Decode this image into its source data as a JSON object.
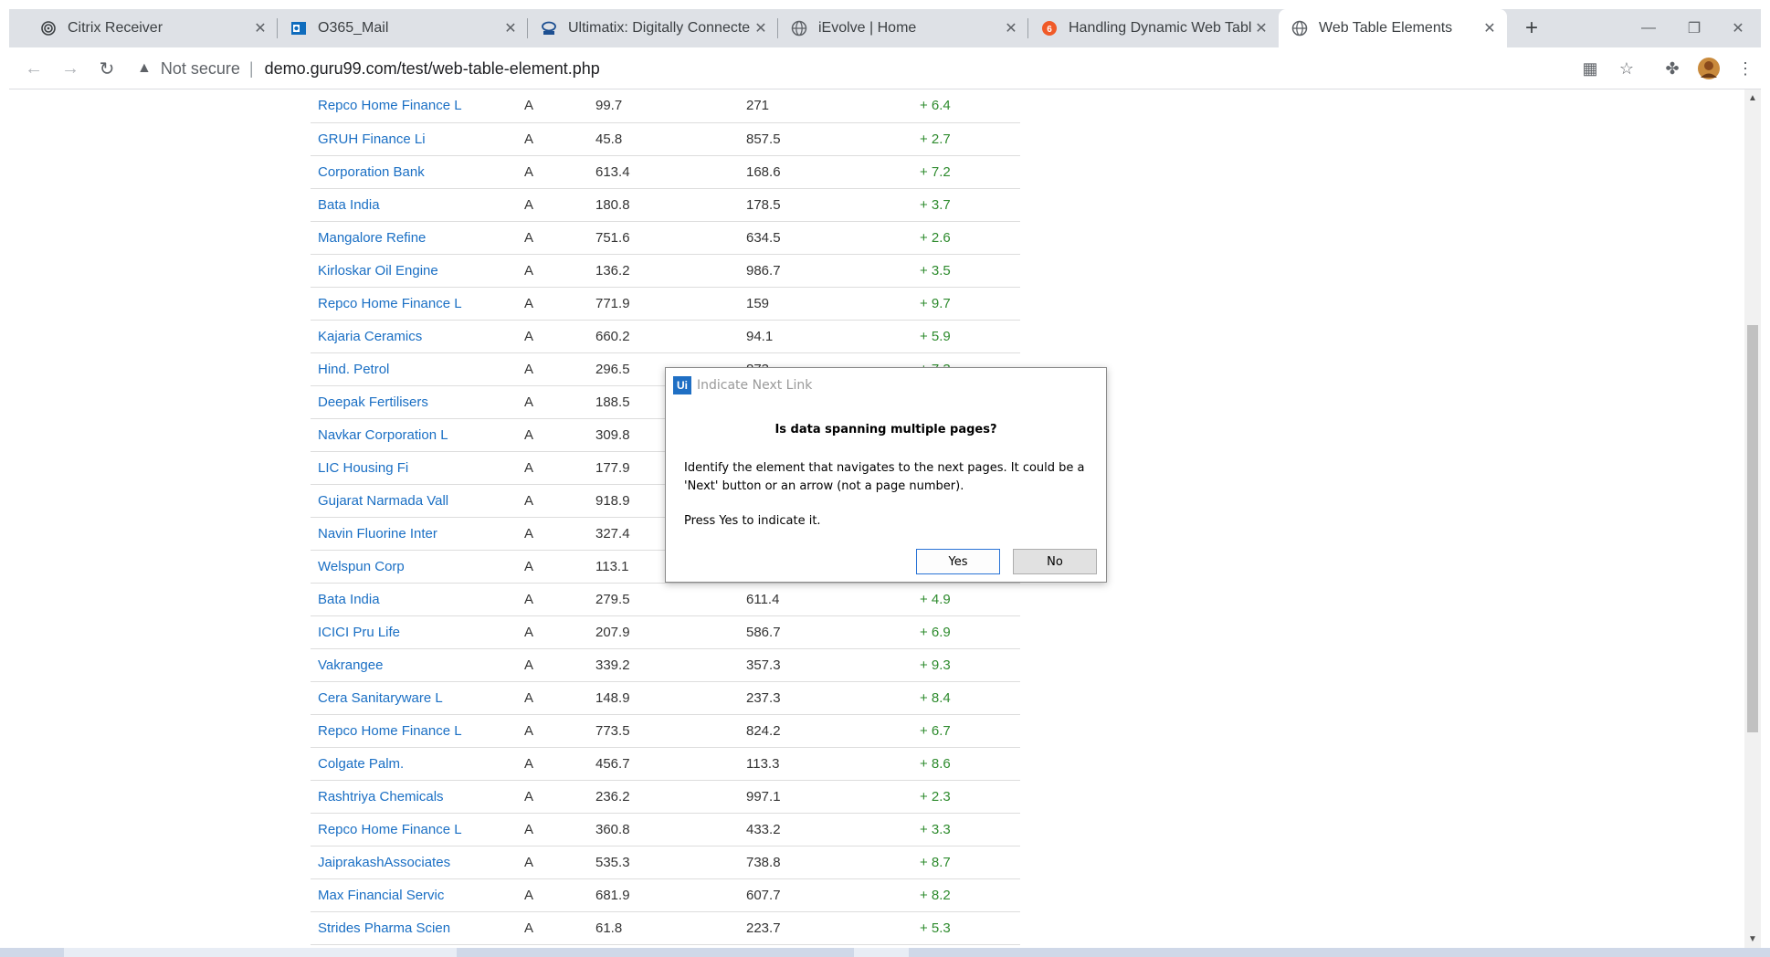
{
  "browser": {
    "tabs": [
      {
        "title": "Citrix Receiver",
        "icon": "citrix-icon"
      },
      {
        "title": "O365_Mail",
        "icon": "outlook-icon"
      },
      {
        "title": "Ultimatix: Digitally Connecte",
        "icon": "tata-icon"
      },
      {
        "title": "iEvolve | Home",
        "icon": "globe-icon"
      },
      {
        "title": "Handling Dynamic Web Tabl",
        "icon": "guru99-icon"
      },
      {
        "title": "Web Table Elements",
        "icon": "globe-icon"
      }
    ],
    "active_tab": 5,
    "security_label": "Not secure",
    "url": "demo.guru99.com/test/web-table-element.php"
  },
  "table": {
    "rows": [
      {
        "company": "Repco Home Finance L",
        "group": "A",
        "prev_close": "99.7",
        "current_price": "271",
        "change": "+ 6.4"
      },
      {
        "company": "GRUH Finance Li",
        "group": "A",
        "prev_close": "45.8",
        "current_price": "857.5",
        "change": "+ 2.7"
      },
      {
        "company": "Corporation Bank",
        "group": "A",
        "prev_close": "613.4",
        "current_price": "168.6",
        "change": "+ 7.2"
      },
      {
        "company": "Bata India",
        "group": "A",
        "prev_close": "180.8",
        "current_price": "178.5",
        "change": "+ 3.7"
      },
      {
        "company": "Mangalore Refine",
        "group": "A",
        "prev_close": "751.6",
        "current_price": "634.5",
        "change": "+ 2.6"
      },
      {
        "company": "Kirloskar Oil Engine",
        "group": "A",
        "prev_close": "136.2",
        "current_price": "986.7",
        "change": "+ 3.5"
      },
      {
        "company": "Repco Home Finance L",
        "group": "A",
        "prev_close": "771.9",
        "current_price": "159",
        "change": "+ 9.7"
      },
      {
        "company": "Kajaria Ceramics",
        "group": "A",
        "prev_close": "660.2",
        "current_price": "94.1",
        "change": "+ 5.9"
      },
      {
        "company": "Hind. Petrol",
        "group": "A",
        "prev_close": "296.5",
        "current_price": "873",
        "change": "+ 7.3"
      },
      {
        "company": "Deepak Fertilisers",
        "group": "A",
        "prev_close": "188.5",
        "current_price": "",
        "change": ""
      },
      {
        "company": "Navkar Corporation L",
        "group": "A",
        "prev_close": "309.8",
        "current_price": "",
        "change": ""
      },
      {
        "company": "LIC Housing Fi",
        "group": "A",
        "prev_close": "177.9",
        "current_price": "",
        "change": ""
      },
      {
        "company": "Gujarat Narmada Vall",
        "group": "A",
        "prev_close": "918.9",
        "current_price": "",
        "change": ""
      },
      {
        "company": "Navin Fluorine Inter",
        "group": "A",
        "prev_close": "327.4",
        "current_price": "",
        "change": ""
      },
      {
        "company": "Welspun Corp",
        "group": "A",
        "prev_close": "113.1",
        "current_price": "",
        "change": ""
      },
      {
        "company": "Bata India",
        "group": "A",
        "prev_close": "279.5",
        "current_price": "611.4",
        "change": "+ 4.9"
      },
      {
        "company": "ICICI Pru Life",
        "group": "A",
        "prev_close": "207.9",
        "current_price": "586.7",
        "change": "+ 6.9"
      },
      {
        "company": "Vakrangee",
        "group": "A",
        "prev_close": "339.2",
        "current_price": "357.3",
        "change": "+ 9.3"
      },
      {
        "company": "Cera Sanitaryware L",
        "group": "A",
        "prev_close": "148.9",
        "current_price": "237.3",
        "change": "+ 8.4"
      },
      {
        "company": "Repco Home Finance L",
        "group": "A",
        "prev_close": "773.5",
        "current_price": "824.2",
        "change": "+ 6.7"
      },
      {
        "company": "Colgate Palm.",
        "group": "A",
        "prev_close": "456.7",
        "current_price": "113.3",
        "change": "+ 8.6"
      },
      {
        "company": "Rashtriya Chemicals",
        "group": "A",
        "prev_close": "236.2",
        "current_price": "997.1",
        "change": "+ 2.3"
      },
      {
        "company": "Repco Home Finance L",
        "group": "A",
        "prev_close": "360.8",
        "current_price": "433.2",
        "change": "+ 3.3"
      },
      {
        "company": "JaiprakashAssociates",
        "group": "A",
        "prev_close": "535.3",
        "current_price": "738.8",
        "change": "+ 8.7"
      },
      {
        "company": "Max Financial Servic",
        "group": "A",
        "prev_close": "681.9",
        "current_price": "607.7",
        "change": "+ 8.2"
      },
      {
        "company": "Strides Pharma Scien",
        "group": "A",
        "prev_close": "61.8",
        "current_price": "223.7",
        "change": "+ 5.3"
      }
    ]
  },
  "dialog": {
    "app_badge": "Ui",
    "title": "Indicate Next Link",
    "question": "Is data spanning multiple pages?",
    "body": "Identify the element that navigates to the next pages. It could be a 'Next' button or an arrow (not a page number).",
    "press": "Press Yes to indicate it.",
    "yes_label": "Yes",
    "no_label": "No"
  },
  "colors": {
    "link": "#1a6fc4",
    "change_positive": "#2e8b2e",
    "tabstrip_bg": "#dee1e6",
    "uipath_blue": "#1f6fc4"
  }
}
